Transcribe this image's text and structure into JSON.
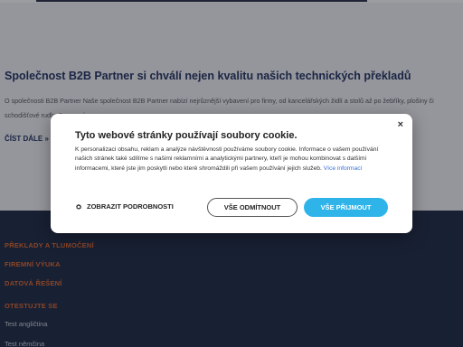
{
  "article": {
    "title": "Společnost B2B Partner si chválí nejen kvalitu našich technických překladů",
    "excerpt": "O společnosti B2B Partner Naše společnost B2B Partner nabízí nejrůznější vybavení pro firmy, od kancelářských židlí a stolů až po žebříky, plošiny či schodišťové rudly. Je pro nás...",
    "read_more": "ČÍST DÁLE »"
  },
  "footer": {
    "links": [
      "PŘEKLADY A TLUMOČENÍ",
      "FIREMNÍ VÝUKA",
      "DATOVÁ ŘEŠENÍ",
      "OTESTUJTE SE"
    ],
    "sub_links": [
      "Test angličtina",
      "Test němčina"
    ]
  },
  "cookie_dialog": {
    "close": "×",
    "title": "Tyto webové stránky používají soubory cookie.",
    "text": "K personalizaci obsahu, reklam a analýze návštěvnosti používáme soubory cookie. Informace o vašem používání našich stránek také sdílíme s našimi reklamními a analytickými partnery, kteří je mohou kombinovat s dalšími informacemi, které jste jim poskytli nebo které shromáždili při vašem používání jejich služeb.",
    "more_info": "Více informací",
    "details_label": "ZOBRAZIT PODROBNOSTI",
    "decline_label": "VŠE ODMÍTNOUT",
    "accept_label": "VŠE PŘIJMOUT"
  },
  "colors": {
    "brand_navy": "#22315f",
    "footer_bg": "#1c2843",
    "footer_accent": "#e0682d",
    "accept_button": "#2fb4ea"
  },
  "icons": {
    "details": "gear-icon",
    "close": "close-icon"
  }
}
